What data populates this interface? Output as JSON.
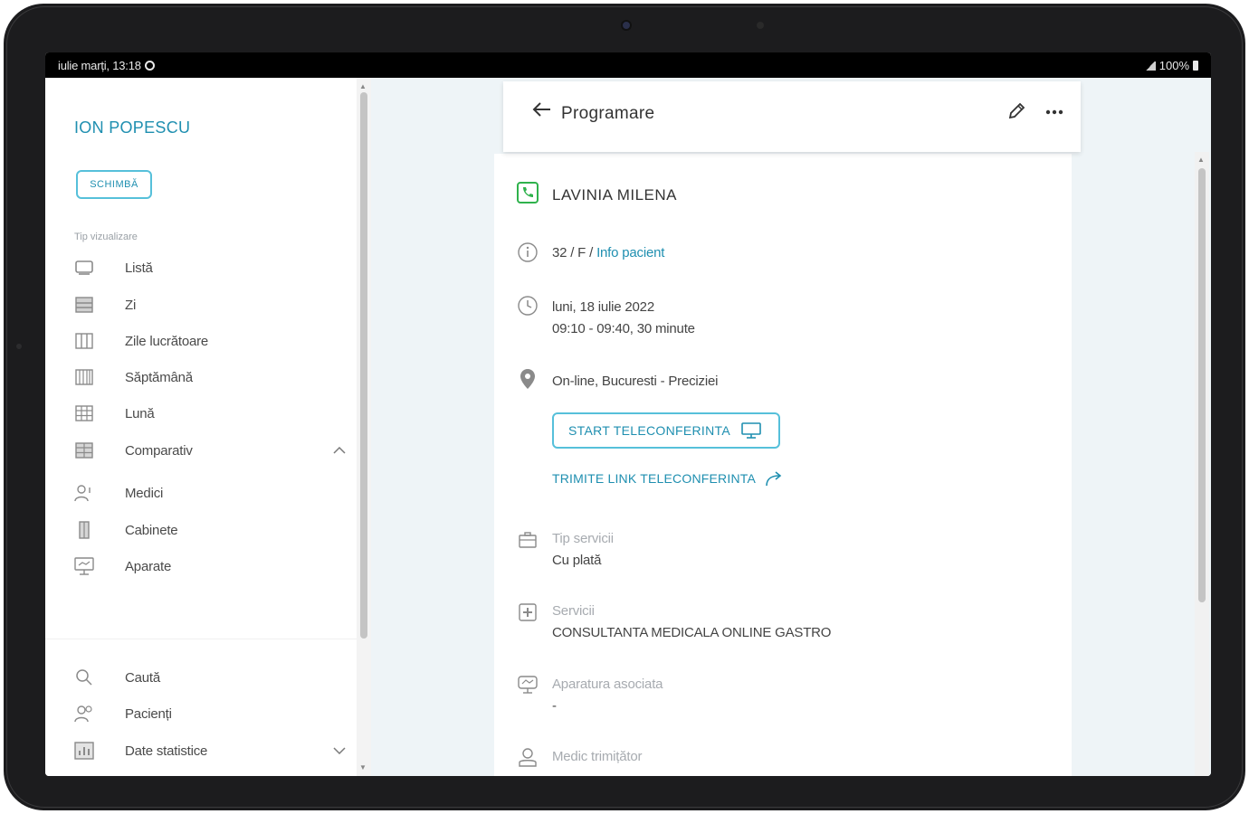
{
  "statusbar": {
    "datetime": "iulie marți, 13:18",
    "battery": "100%"
  },
  "sidebar": {
    "user_name": "ION POPESCU",
    "change_label": "SCHIMBĂ",
    "section_label": "Tip vizualizare",
    "view_items": [
      {
        "label": "Listă",
        "icon": "list-icon"
      },
      {
        "label": "Zi",
        "icon": "day-icon"
      },
      {
        "label": "Zile lucrătoare",
        "icon": "workdays-icon"
      },
      {
        "label": "Săptămână",
        "icon": "week-icon"
      },
      {
        "label": "Lună",
        "icon": "month-icon"
      },
      {
        "label": "Comparativ",
        "icon": "compare-icon",
        "chevron": "up"
      },
      {
        "label": "Medici",
        "icon": "doctors-icon"
      },
      {
        "label": "Cabinete",
        "icon": "cabinet-icon"
      },
      {
        "label": "Aparate",
        "icon": "devices-icon"
      }
    ],
    "bottom_items": [
      {
        "label": "Caută",
        "icon": "search-icon"
      },
      {
        "label": "Pacienți",
        "icon": "patients-icon"
      },
      {
        "label": "Date statistice",
        "icon": "stats-icon",
        "chevron": "down"
      }
    ]
  },
  "header": {
    "title": "Programare"
  },
  "appointment": {
    "patient_name": "LAVINIA MILENA",
    "patient_meta": "32 / F / ",
    "patient_info_link": "Info pacient",
    "date": "luni, 18 iulie 2022",
    "time": "09:10 - 09:40, 30 minute",
    "location": "On-line, Bucuresti - Preciziei",
    "start_tele_label": "START TELECONFERINTA",
    "send_link_label": "TRIMITE LINK TELECONFERINTA",
    "service_type_label": "Tip servicii",
    "service_type_value": "Cu plată",
    "services_label": "Servicii",
    "services_value": "CONSULTANTA MEDICALA ONLINE GASTRO",
    "equipment_label": "Aparatura asociata",
    "equipment_value": "-",
    "referring_label": "Medic trimițător"
  },
  "colors": {
    "accent": "#1f8fb0",
    "accent_border": "#56c0da",
    "phone_green": "#2fb24c",
    "main_bg": "#eef4f7"
  }
}
